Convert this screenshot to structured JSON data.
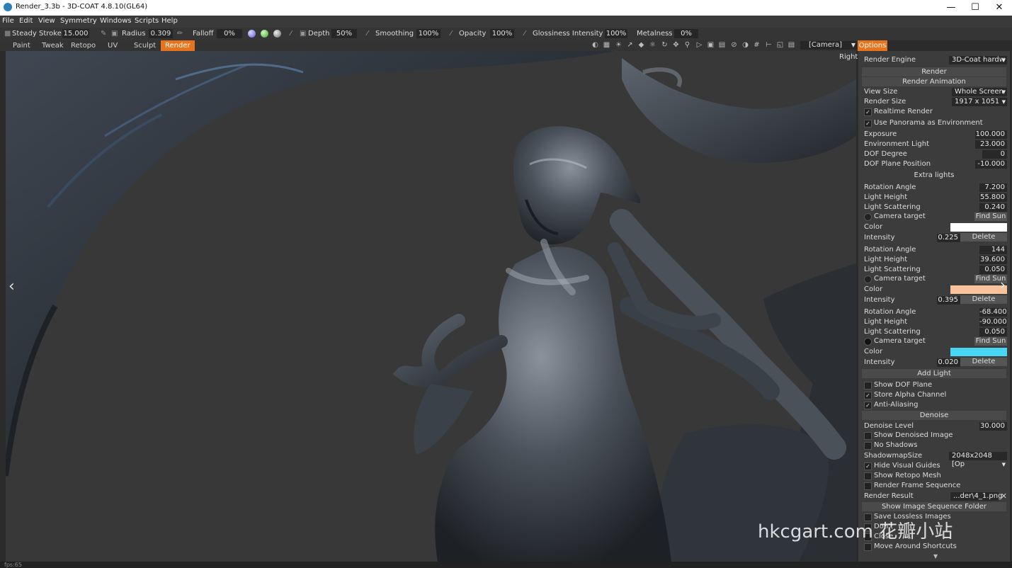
{
  "window": {
    "title": "Render_3.3b - 3D-COAT 4.8.10(GL64)"
  },
  "menu": [
    "File",
    "Edit",
    "View",
    "Symmetry",
    "Windows",
    "Scripts",
    "Help"
  ],
  "toolbar": {
    "steady_stroke_label": "Steady Stroke",
    "steady_stroke_value": "15.000",
    "radius_label": "Radius",
    "radius_value": "0.309",
    "falloff_label": "Falloff",
    "falloff_value": "0%",
    "depth_label": "Depth",
    "depth_value": "50%",
    "smoothing_label": "Smoothing",
    "smoothing_value": "100%",
    "opacity_label": "Opacity",
    "opacity_value": "100%",
    "glossiness_label": "Glossiness Intensity",
    "glossiness_value": "100%",
    "metalness_label": "Metalness",
    "metalness_value": "0%"
  },
  "rooms": [
    "Paint",
    "Tweak",
    "Retopo",
    "UV",
    "Sculpt",
    "Render"
  ],
  "active_room": "Render",
  "camera_select": "[Camera]",
  "viewport": {
    "view_label": "Right"
  },
  "panel": {
    "tab": "Options",
    "render_engine_label": "Render Engine",
    "render_engine_value": "3D-Coat hardw",
    "render_button": "Render",
    "render_animation_button": "Render Animation",
    "view_size_label": "View Size",
    "view_size_value": "Whole Screen",
    "render_size_label": "Render Size",
    "render_size_value": "1917  x  1051",
    "realtime_render": "Realtime Render",
    "use_panorama": "Use Panorama as Environment",
    "exposure_label": "Exposure",
    "exposure_value": "100.000",
    "env_light_label": "Environment Light",
    "env_light_value": "23.000",
    "dof_degree_label": "DOF Degree",
    "dof_degree_value": "0",
    "dof_plane_label": "DOF Plane Position",
    "dof_plane_value": "-10.000",
    "extra_lights_header": "Extra lights",
    "lights": [
      {
        "rotation": "7.200",
        "height": "55.800",
        "scattering": "0.240",
        "intensity": "0.225",
        "color": "#ffffff"
      },
      {
        "rotation": "144",
        "height": "39.600",
        "scattering": "0.050",
        "intensity": "0.395",
        "color": "#f8c29a"
      },
      {
        "rotation": "-68.400",
        "height": "-90.000",
        "scattering": "0.050",
        "intensity": "0.020",
        "color": "#48d6f4"
      }
    ],
    "rotation_label": "Rotation Angle",
    "height_label": "Light Height",
    "scattering_label": "Light Scattering",
    "camera_target_label": "Camera  target",
    "find_sun": "Find Sun",
    "color_label": "Color",
    "intensity_label": "Intensity",
    "delete_label": "Delete",
    "add_light": "Add Light",
    "show_dof_plane": "Show DOF Plane",
    "store_alpha": "Store Alpha Channel",
    "anti_aliasing": "Anti-Aliasing",
    "denoise_button": "Denoise",
    "denoise_level_label": "Denoise Level",
    "denoise_level_value": "30.000",
    "show_denoised": "Show Denoised Image",
    "no_shadows": "No Shadows",
    "shadowmap_label": "ShadowmapSize",
    "shadowmap_value": "2048x2048 [Op",
    "hide_visual_guides": "Hide Visual Guides",
    "show_retopo_mesh": "Show Retopo Mesh",
    "render_frame_seq": "Render Frame Sequence",
    "render_result_label": "Render Result",
    "render_result_value": "...der\\4_1.png",
    "show_image_seq_folder": "Show Image Sequence Folder",
    "save_lossless": "Save Lossless Images",
    "dont": "Don't",
    "close": "Close",
    "move_around": "Move Around Shortcuts"
  },
  "status": {
    "fps": "fps:65"
  },
  "watermark": "hkcgart.com 花瓣小站"
}
